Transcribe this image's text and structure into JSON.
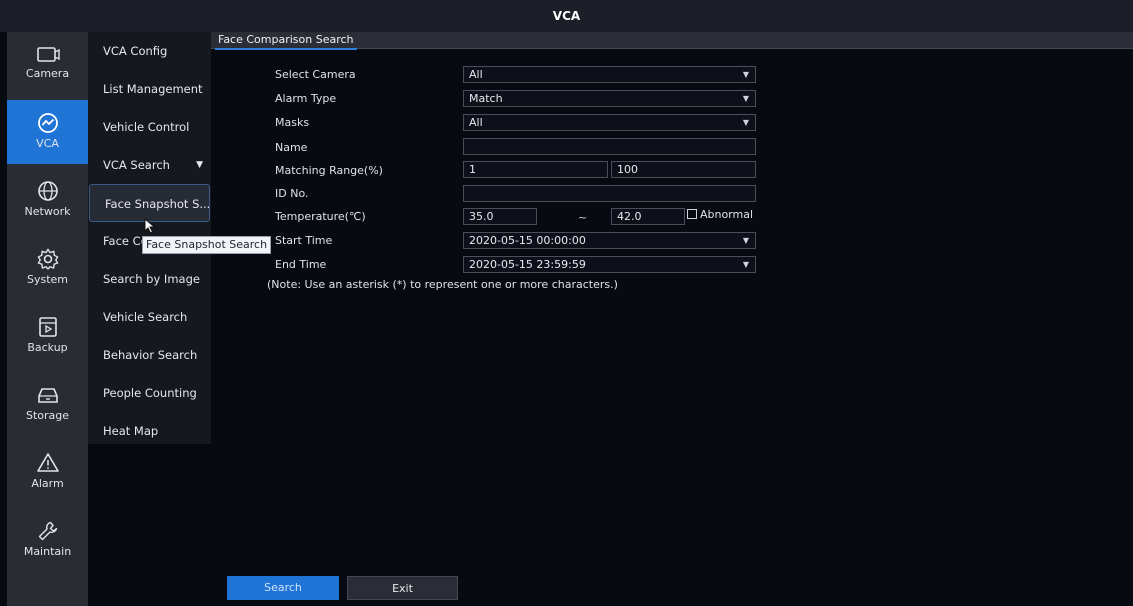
{
  "window": {
    "title": "VCA"
  },
  "rail": {
    "items": [
      {
        "label": "Camera",
        "icon": "camera-icon"
      },
      {
        "label": "VCA",
        "icon": "vca-icon",
        "active": true
      },
      {
        "label": "Network",
        "icon": "globe-icon"
      },
      {
        "label": "System",
        "icon": "gear-icon"
      },
      {
        "label": "Backup",
        "icon": "backup-icon"
      },
      {
        "label": "Storage",
        "icon": "storage-icon"
      },
      {
        "label": "Alarm",
        "icon": "alarm-icon"
      },
      {
        "label": "Maintain",
        "icon": "wrench-icon"
      }
    ]
  },
  "subnav": {
    "items": [
      {
        "label": "VCA Config"
      },
      {
        "label": "List Management"
      },
      {
        "label": "Vehicle Control"
      },
      {
        "label": "VCA Search",
        "expanded": true
      },
      {
        "label": "Face Snapshot S...",
        "selected": true
      },
      {
        "label": "Face Comparison"
      },
      {
        "label": "Search by Image"
      },
      {
        "label": "Vehicle Search"
      },
      {
        "label": "Behavior Search"
      },
      {
        "label": "People Counting"
      },
      {
        "label": "Heat Map"
      }
    ]
  },
  "tooltip": {
    "text": "Face Snapshot Search"
  },
  "tab": {
    "label": "Face Comparison Search"
  },
  "form": {
    "select_camera": {
      "label": "Select Camera",
      "value": "All"
    },
    "alarm_type": {
      "label": "Alarm Type",
      "value": "Match"
    },
    "masks": {
      "label": "Masks",
      "value": "All"
    },
    "name": {
      "label": "Name",
      "value": ""
    },
    "matching_range": {
      "label": "Matching Range(%)",
      "min": "1",
      "max": "100"
    },
    "id_no": {
      "label": "ID No.",
      "value": ""
    },
    "temperature": {
      "label": "Temperature(℃)",
      "min": "35.0",
      "separator": "~",
      "max": "42.0",
      "abnormal_label": "Abnormal",
      "abnormal_checked": false
    },
    "start_time": {
      "label": "Start Time",
      "value": "2020-05-15 00:00:00"
    },
    "end_time": {
      "label": "End Time",
      "value": "2020-05-15 23:59:59"
    },
    "note": "(Note: Use an asterisk (*) to represent one or more characters.)"
  },
  "buttons": {
    "search": "Search",
    "exit": "Exit"
  },
  "colors": {
    "accent": "#1f74d6",
    "background": "#080a12",
    "rail": "#2a2c33"
  }
}
